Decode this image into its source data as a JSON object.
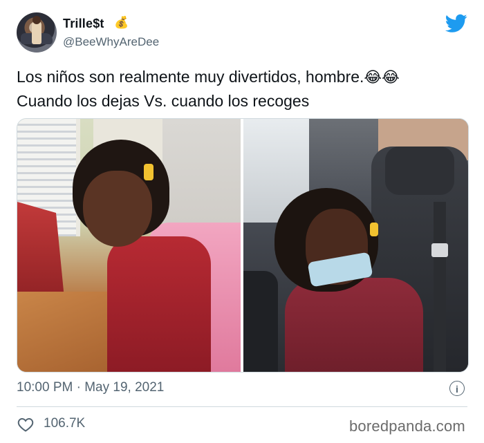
{
  "author": {
    "display_name": "Trille$t",
    "name_emoji": "💰",
    "handle": "@BeeWhyAreDee"
  },
  "tweet": {
    "line1": "Los niños son realmente muy divertidos, hombre.",
    "line1_emoji": "😂😂",
    "line2": "Cuando los dejas Vs. cuando los recoges"
  },
  "media": {
    "photos": [
      "girl-smiling-morning",
      "girl-in-car-after-school"
    ]
  },
  "meta": {
    "time": "10:00 PM",
    "separator": "·",
    "date": "May 19, 2021",
    "info_glyph": "i"
  },
  "stats": {
    "likes": "106.7K"
  },
  "watermark": "boredpanda.com",
  "colors": {
    "twitter_blue": "#1d9bf0",
    "secondary_text": "#536471",
    "divider": "#cfd9de"
  },
  "icons": {
    "brand": "twitter-bird-icon",
    "info": "info-icon",
    "like": "heart-icon"
  }
}
